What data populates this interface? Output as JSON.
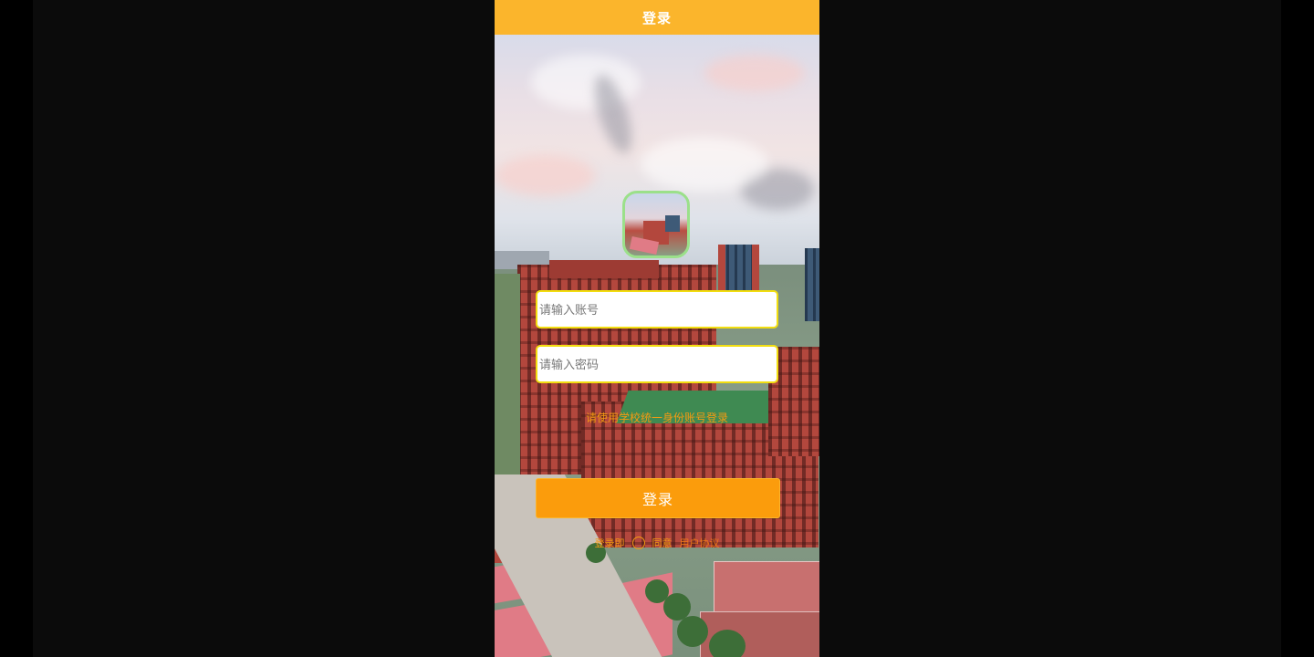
{
  "header": {
    "title": "登录"
  },
  "form": {
    "account_placeholder": "请输入账号",
    "password_placeholder": "请输入密码",
    "note": "请使用学校统一身份账号登录",
    "login_label": "登录"
  },
  "agreement": {
    "prefix": "登录即",
    "middle": "同意",
    "link": "用户协议"
  },
  "colors": {
    "header_bg": "#fbb52c",
    "button_bg": "#fb9c0c",
    "input_border": "#f2de10",
    "avatar_border": "#9be08a",
    "note_text": "#f59a12"
  }
}
